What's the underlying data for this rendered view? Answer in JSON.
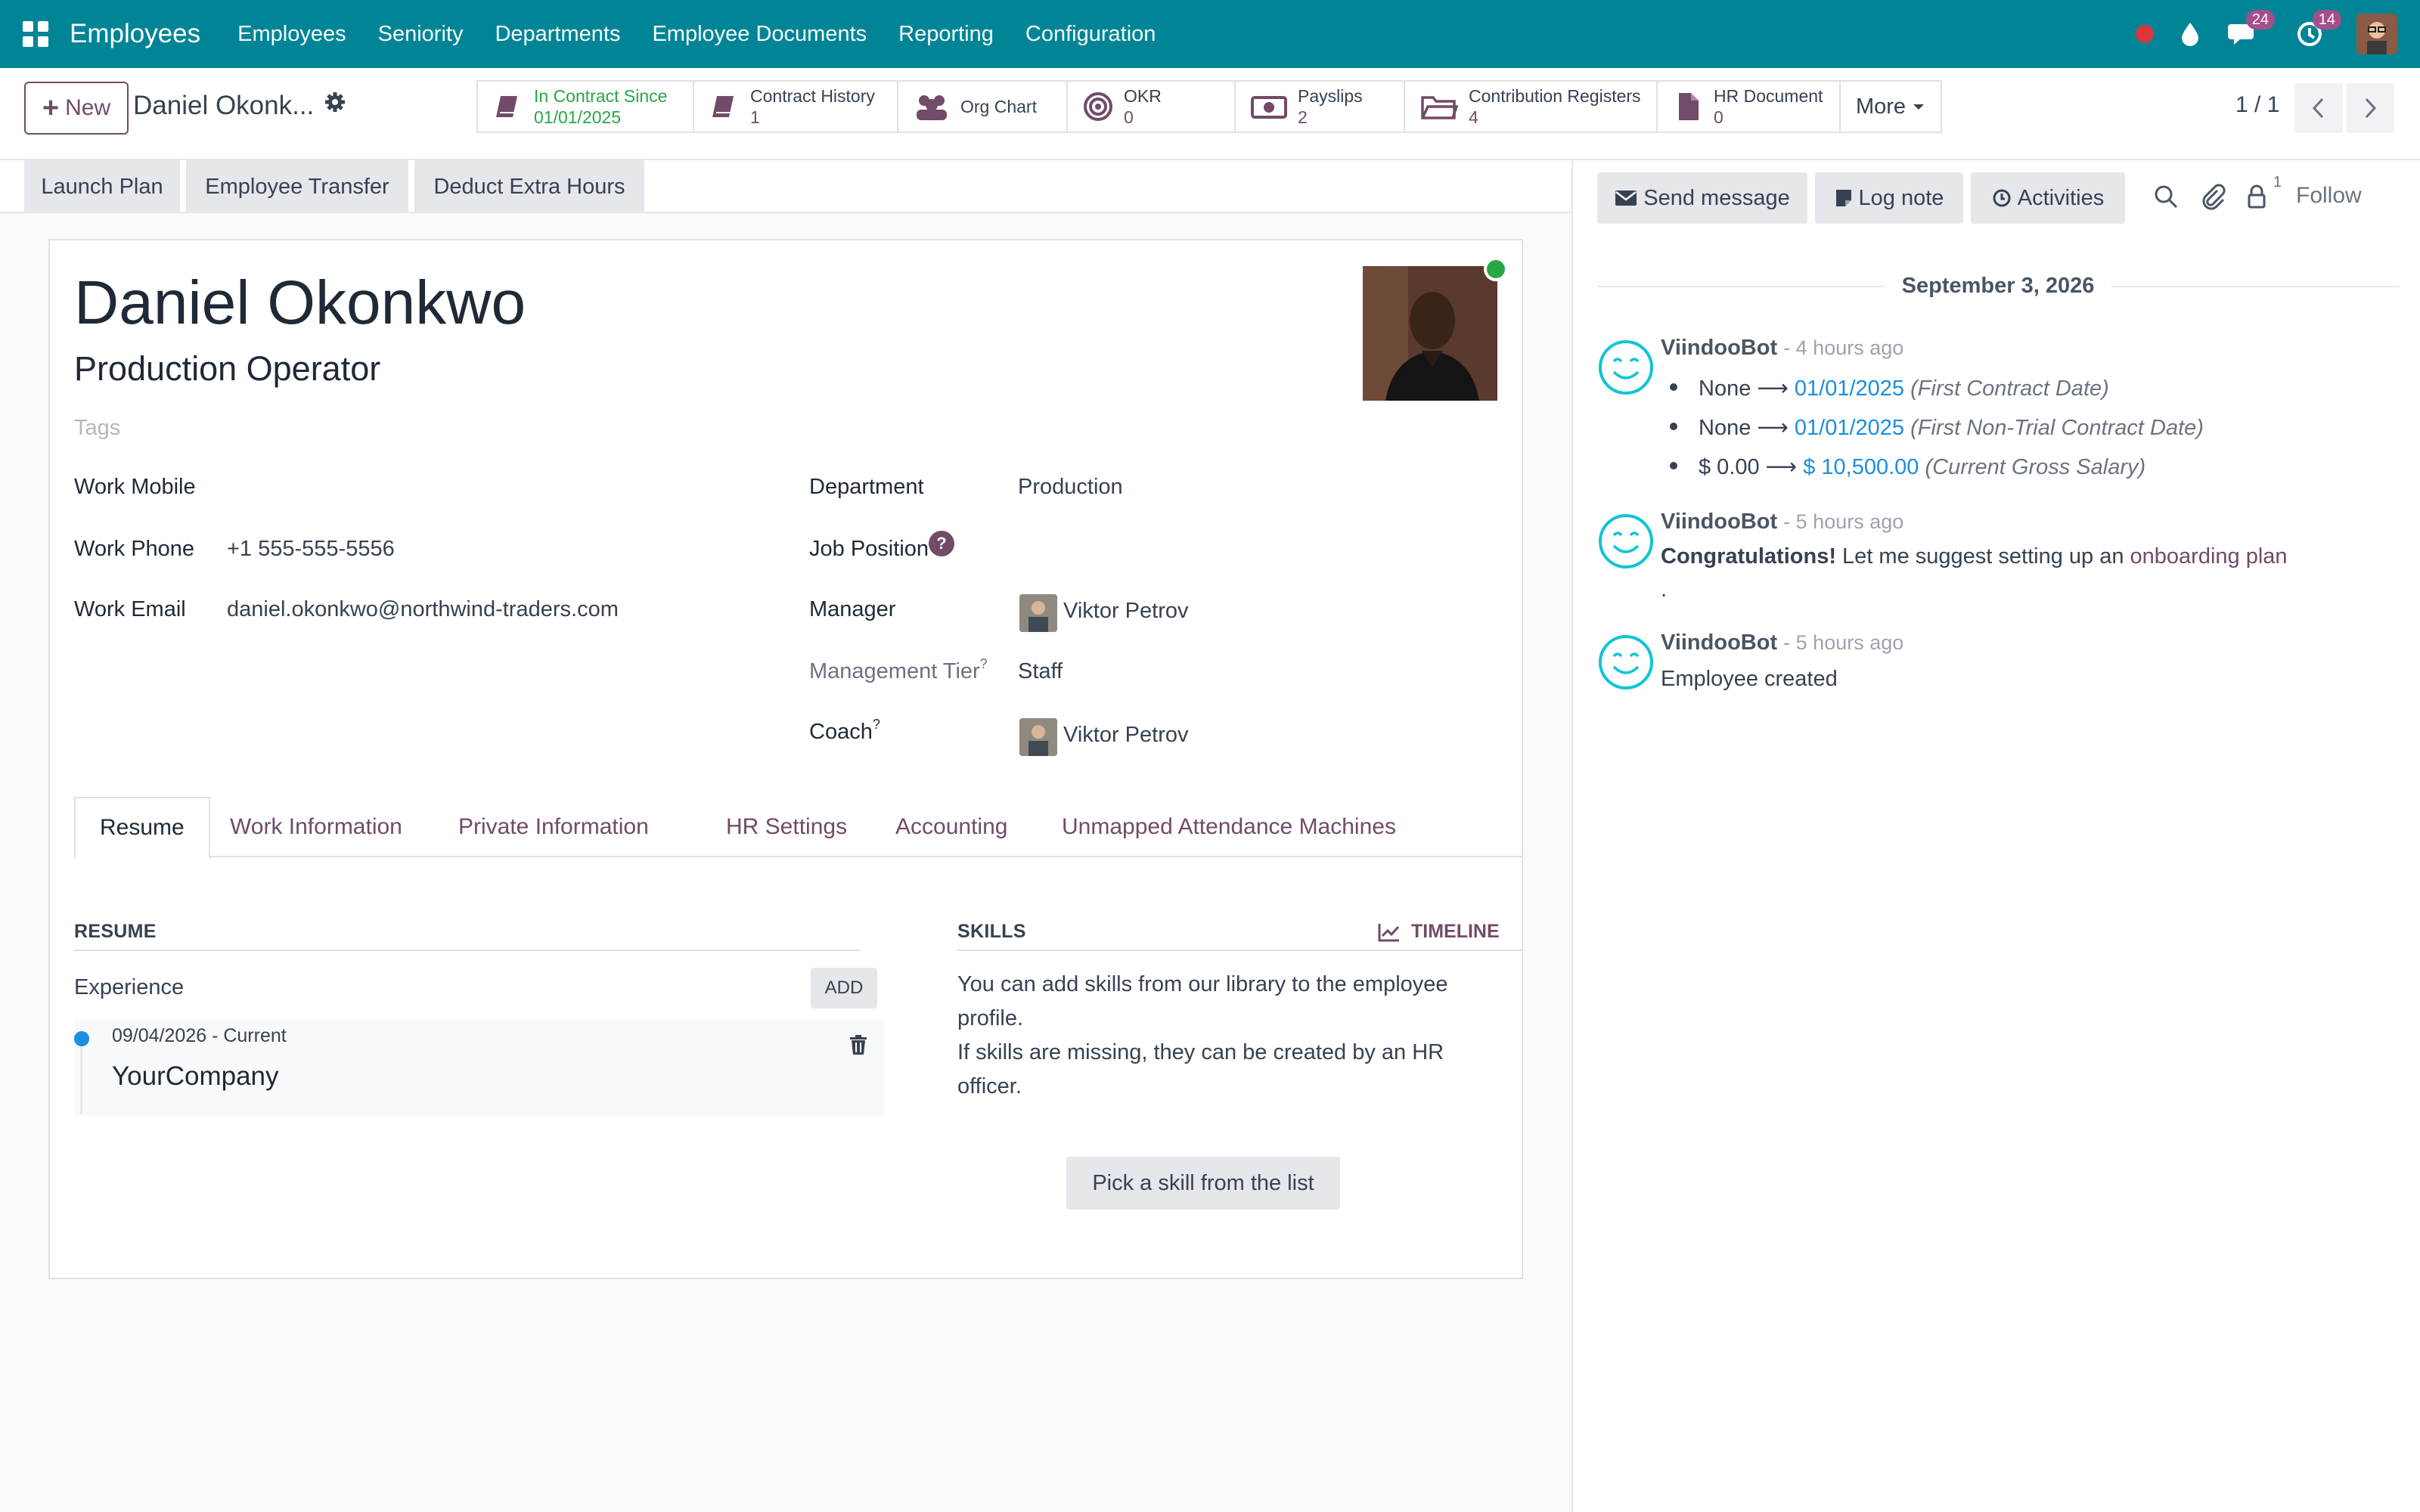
{
  "navbar": {
    "brand": "Employees",
    "menu": [
      "Employees",
      "Seniority",
      "Departments",
      "Employee Documents",
      "Reporting",
      "Configuration"
    ],
    "messages_badge": "24",
    "activities_badge": "14",
    "accent_color": "#018596"
  },
  "control_panel": {
    "new_label": "New",
    "breadcrumb": "Daniel Okonk...",
    "smart_buttons": [
      {
        "label": "In Contract Since",
        "value": "01/01/2025",
        "icon": "book-icon"
      },
      {
        "label": "Contract History",
        "value": "1",
        "icon": "book-icon"
      },
      {
        "label": "Org Chart",
        "value": "",
        "icon": "users-icon"
      },
      {
        "label": "OKR",
        "value": "0",
        "icon": "target-icon"
      },
      {
        "label": "Payslips",
        "value": "2",
        "icon": "money-icon"
      },
      {
        "label": "Contribution Registers",
        "value": "4",
        "icon": "folder-icon"
      },
      {
        "label": "HR Document",
        "value": "0",
        "icon": "file-icon"
      }
    ],
    "more_label": "More",
    "pager": "1 / 1"
  },
  "actions": [
    "Launch Plan",
    "Employee Transfer",
    "Deduct Extra Hours"
  ],
  "employee": {
    "name": "Daniel Okonkwo",
    "job_title": "Production Operator",
    "tags_placeholder": "Tags",
    "work_mobile_label": "Work Mobile",
    "work_mobile": "",
    "work_phone_label": "Work Phone",
    "work_phone": "+1 555-555-5556",
    "work_email_label": "Work Email",
    "work_email": "daniel.okonkwo@northwind-traders.com",
    "department_label": "Department",
    "department": "Production",
    "job_position_label": "Job Position",
    "job_position_help": "?",
    "manager_label": "Manager",
    "manager": "Viktor Petrov",
    "management_tier_label": "Management Tier",
    "management_tier": "Staff",
    "coach_label": "Coach",
    "coach": "Viktor Petrov",
    "tooltip_mark": "?"
  },
  "tabs": [
    "Resume",
    "Work Information",
    "Private Information",
    "HR Settings",
    "Accounting",
    "Unmapped Attendance Machines"
  ],
  "resume": {
    "title": "RESUME",
    "experience_label": "Experience",
    "add_label": "ADD",
    "lines": [
      {
        "date": "09/04/2026 - Current",
        "name": "YourCompany"
      }
    ]
  },
  "skills": {
    "title": "SKILLS",
    "timeline_label": "TIMELINE",
    "text_1": "You can add skills from our library to the employee profile.",
    "text_2": "If skills are missing, they can be created by an HR officer.",
    "pick_label": "Pick a skill from the list"
  },
  "chatter": {
    "send_message": "Send message",
    "log_note": "Log note",
    "activities": "Activities",
    "followers_count": "1",
    "follow": "Follow",
    "date": "September 3, 2026",
    "messages": [
      {
        "author": "ViindooBot",
        "time": "- 4 hours ago",
        "changes": [
          {
            "old": "None",
            "new": "01/01/2025",
            "field": "(First Contract Date)"
          },
          {
            "old": "None",
            "new": "01/01/2025",
            "field": "(First Non-Trial Contract Date)"
          },
          {
            "old": "$ 0.00",
            "new": "$ 10,500.00",
            "field": "(Current Gross Salary)"
          }
        ]
      },
      {
        "author": "ViindooBot",
        "time": "- 5 hours ago",
        "bold": "Congratulations!",
        "text": " Let me suggest setting up an ",
        "link": "onboarding plan",
        "tail": "."
      },
      {
        "author": "ViindooBot",
        "time": "- 5 hours ago",
        "text": "Employee created"
      }
    ]
  }
}
